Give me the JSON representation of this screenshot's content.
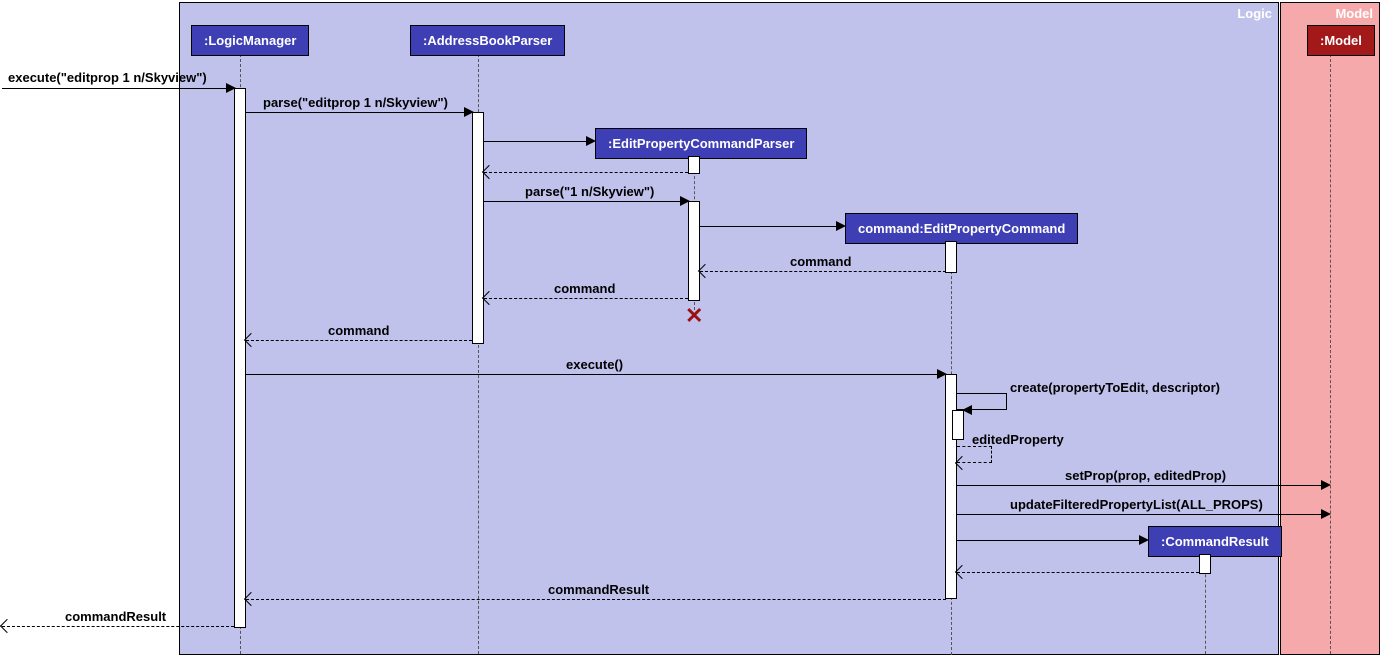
{
  "frames": {
    "logic": "Logic",
    "model": "Model"
  },
  "participants": {
    "logicManager": ":LogicManager",
    "addressBookParser": ":AddressBookParser",
    "editPropParser": ":EditPropertyCommandParser",
    "editPropCommand": "command:EditPropertyCommand",
    "commandResult": ":CommandResult",
    "model": ":Model"
  },
  "messages": {
    "executeEntry": "execute(\"editprop 1 n/Skyview\")",
    "parse1": "parse(\"editprop 1 n/Skyview\")",
    "parse2": "parse(\"1 n/Skyview\")",
    "returnCommand1": "command",
    "returnCommand2": "command",
    "returnCommand3": "command",
    "execute2": "execute()",
    "create": "create(propertyToEdit, descriptor)",
    "editedProperty": "editedProperty",
    "setProp": "setProp(prop, editedProp)",
    "updateFilteredList": "updateFilteredPropertyList(ALL_PROPS)",
    "returnCommandResult1": "commandResult",
    "returnCommandResult2": "commandResult"
  },
  "chart_data": {
    "type": "sequence-diagram",
    "frames": [
      {
        "name": "Logic",
        "contains": [
          "LogicManager",
          "AddressBookParser",
          "EditPropertyCommandParser",
          "command:EditPropertyCommand",
          "CommandResult"
        ]
      },
      {
        "name": "Model",
        "contains": [
          "Model"
        ]
      }
    ],
    "participants": [
      {
        "id": "entry",
        "name": "(external)"
      },
      {
        "id": "LM",
        "name": ":LogicManager"
      },
      {
        "id": "ABP",
        "name": ":AddressBookParser"
      },
      {
        "id": "EPCP",
        "name": ":EditPropertyCommandParser",
        "createdAt": 3,
        "destroyedAt": 8
      },
      {
        "id": "EPC",
        "name": "command:EditPropertyCommand",
        "createdAt": 5
      },
      {
        "id": "CR",
        "name": ":CommandResult",
        "createdAt": 14
      },
      {
        "id": "M",
        "name": ":Model"
      }
    ],
    "messages": [
      {
        "n": 1,
        "from": "entry",
        "to": "LM",
        "label": "execute(\"editprop 1 n/Skyview\")",
        "type": "sync"
      },
      {
        "n": 2,
        "from": "LM",
        "to": "ABP",
        "label": "parse(\"editprop 1 n/Skyview\")",
        "type": "sync"
      },
      {
        "n": 3,
        "from": "ABP",
        "to": "EPCP",
        "label": "",
        "type": "create"
      },
      {
        "n": 4,
        "from": "EPCP",
        "to": "ABP",
        "label": "",
        "type": "return"
      },
      {
        "n": 5,
        "from": "ABP",
        "to": "EPCP",
        "label": "parse(\"1 n/Skyview\")",
        "type": "sync"
      },
      {
        "n": 6,
        "from": "EPCP",
        "to": "EPC",
        "label": "",
        "type": "create"
      },
      {
        "n": 7,
        "from": "EPC",
        "to": "EPCP",
        "label": "command",
        "type": "return"
      },
      {
        "n": 8,
        "from": "EPCP",
        "to": "ABP",
        "label": "command",
        "type": "return"
      },
      {
        "n": 9,
        "from": "ABP",
        "to": "LM",
        "label": "command",
        "type": "return"
      },
      {
        "n": 10,
        "from": "LM",
        "to": "EPC",
        "label": "execute()",
        "type": "sync"
      },
      {
        "n": 11,
        "from": "EPC",
        "to": "EPC",
        "label": "create(propertyToEdit, descriptor)",
        "type": "self-sync"
      },
      {
        "n": 12,
        "from": "EPC",
        "to": "EPC",
        "label": "editedProperty",
        "type": "self-return"
      },
      {
        "n": 13,
        "from": "EPC",
        "to": "M",
        "label": "setProp(prop, editedProp)",
        "type": "sync"
      },
      {
        "n": 14,
        "from": "EPC",
        "to": "M",
        "label": "updateFilteredPropertyList(ALL_PROPS)",
        "type": "sync"
      },
      {
        "n": 15,
        "from": "EPC",
        "to": "CR",
        "label": "",
        "type": "create"
      },
      {
        "n": 16,
        "from": "CR",
        "to": "EPC",
        "label": "",
        "type": "return"
      },
      {
        "n": 17,
        "from": "EPC",
        "to": "LM",
        "label": "commandResult",
        "type": "return"
      },
      {
        "n": 18,
        "from": "LM",
        "to": "entry",
        "label": "commandResult",
        "type": "return"
      }
    ]
  }
}
